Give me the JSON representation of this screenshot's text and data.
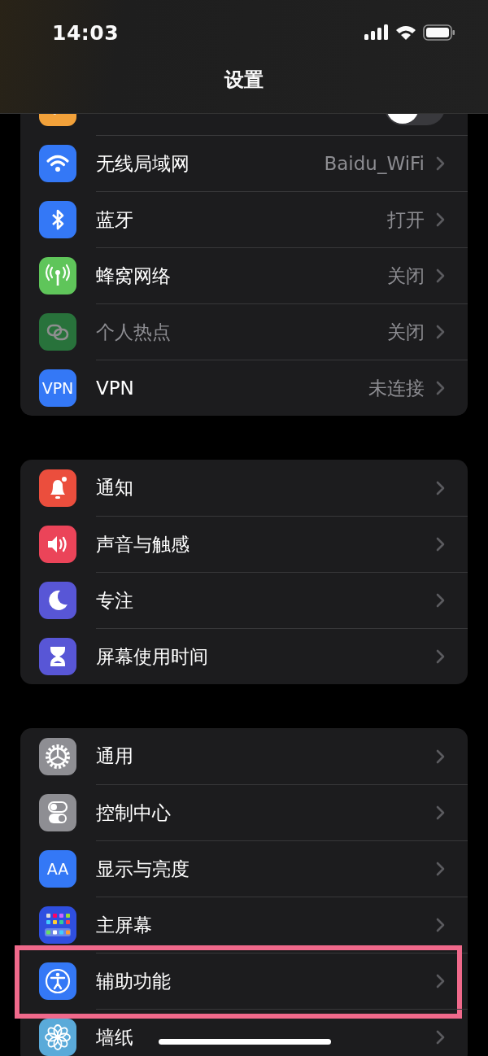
{
  "status_bar": {
    "time": "14:03"
  },
  "navigation": {
    "title": "设置"
  },
  "groups": [
    {
      "rows": [
        {
          "kind": "toggle",
          "on": false,
          "disabled": false,
          "highlighted": false
        },
        {
          "kind": "link",
          "label": "无线局域网",
          "value": "Baidu_WiFi",
          "disabled": false,
          "highlighted": false
        },
        {
          "kind": "link",
          "label": "蓝牙",
          "value": "打开",
          "disabled": false,
          "highlighted": false
        },
        {
          "kind": "link",
          "label": "蜂窝网络",
          "value": "关闭",
          "disabled": false,
          "highlighted": false
        },
        {
          "kind": "link",
          "label": "个人热点",
          "value": "关闭",
          "disabled": true,
          "highlighted": false
        },
        {
          "kind": "link",
          "label": "VPN",
          "value": "未连接",
          "icon_text": "VPN",
          "disabled": false,
          "highlighted": false
        }
      ]
    },
    {
      "rows": [
        {
          "kind": "link",
          "label": "通知",
          "disabled": false,
          "highlighted": false
        },
        {
          "kind": "link",
          "label": "声音与触感",
          "disabled": false,
          "highlighted": false
        },
        {
          "kind": "link",
          "label": "专注",
          "disabled": false,
          "highlighted": false
        },
        {
          "kind": "link",
          "label": "屏幕使用时间",
          "disabled": false,
          "highlighted": false
        }
      ]
    },
    {
      "rows": [
        {
          "kind": "link",
          "label": "通用",
          "disabled": false,
          "highlighted": false
        },
        {
          "kind": "link",
          "label": "控制中心",
          "disabled": false,
          "highlighted": false
        },
        {
          "kind": "link",
          "label": "显示与亮度",
          "icon_text": "AA",
          "disabled": false,
          "highlighted": false
        },
        {
          "kind": "link",
          "label": "主屏幕",
          "disabled": false,
          "highlighted": false
        },
        {
          "kind": "link",
          "label": "辅助功能",
          "disabled": false,
          "highlighted": true
        },
        {
          "kind": "link",
          "label": "墙纸",
          "disabled": false,
          "highlighted": false
        }
      ]
    }
  ]
}
